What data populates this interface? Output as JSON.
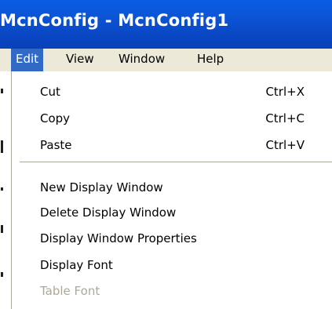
{
  "window": {
    "title": "McnConfig - McnConfig1"
  },
  "menubar": {
    "items": [
      {
        "label": "Edit"
      },
      {
        "label": "View"
      },
      {
        "label": "Window"
      },
      {
        "label": "Help"
      }
    ]
  },
  "edit_menu": {
    "items": [
      {
        "label": "Cut",
        "shortcut": "Ctrl+X"
      },
      {
        "label": "Copy",
        "shortcut": "Ctrl+C"
      },
      {
        "label": "Paste",
        "shortcut": "Ctrl+V"
      },
      {
        "label": "New Display Window"
      },
      {
        "label": "Delete Display Window"
      },
      {
        "label": "Display Window Properties"
      },
      {
        "label": "Display Font"
      },
      {
        "label": "Table Font",
        "state": "disabled"
      }
    ]
  },
  "colors": {
    "titlebar": "#0a56d8",
    "menu_highlight": "#316ac5",
    "menubar_bg": "#ece9d8",
    "disabled_text": "#aca899"
  }
}
